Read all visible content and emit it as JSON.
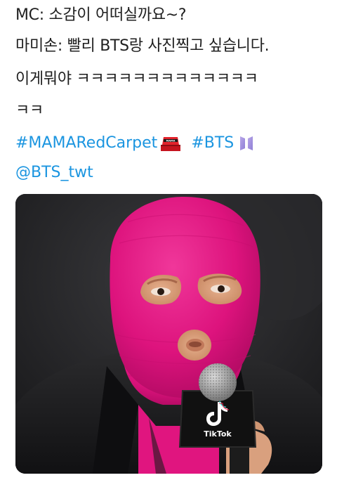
{
  "tweet": {
    "text_lines": [
      "MC: 소감이 어떠실까요~?",
      "마미손: 빨리 BTS랑 사진찍고 싶습니다.",
      "이게뭐야 ㅋㅋㅋㅋㅋㅋㅋㅋㅋㅋㅋㅋㅋ",
      "ㅋㅋ"
    ],
    "hashtags": [
      "#MAMARedCarpet",
      "#BTS"
    ],
    "mention": "@BTS_twt",
    "media": {
      "mic_brand": "TikTok",
      "emoji_mama_text": "MAMA"
    },
    "colors": {
      "link": "#1b95e0",
      "mask": "#e0157f",
      "background": "#ffffff"
    }
  }
}
